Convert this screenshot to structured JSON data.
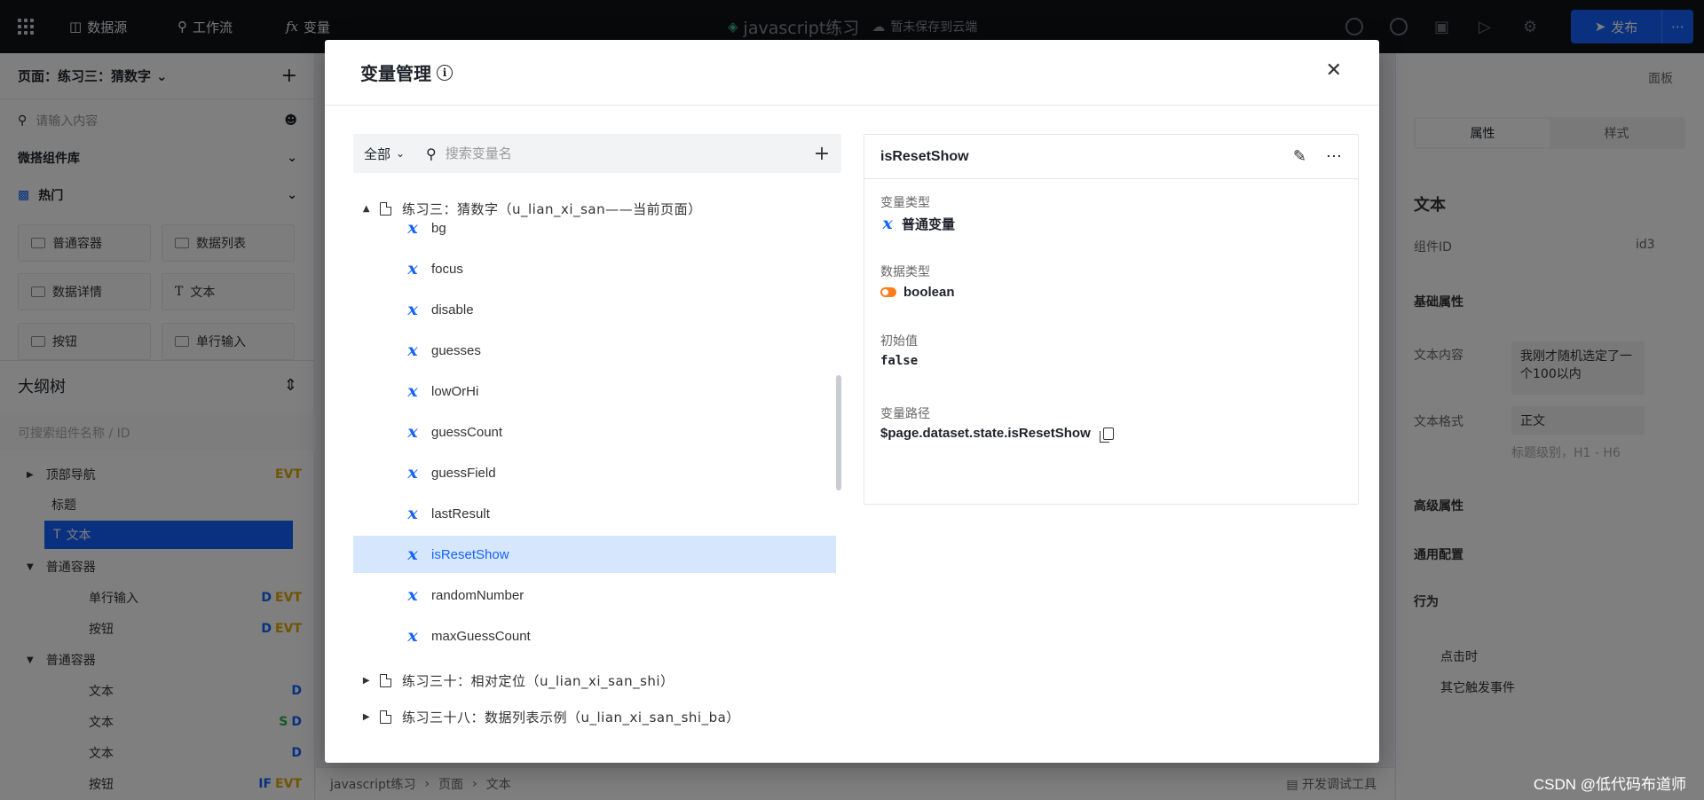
{
  "topbar": {
    "datasource": "数据源",
    "workflow": "工作流",
    "variable": "变量",
    "app_title": "javascript练习",
    "save_status": "暂未保存到云端",
    "publish": "发布"
  },
  "left": {
    "page_label": "页面：练习三：猜数字",
    "search_placeholder": "请输入内容",
    "lib_title": "微搭组件库",
    "hot_title": "热门",
    "cards": [
      "普通容器",
      "数据列表",
      "数据详情",
      "文本",
      "按钮",
      "单行输入"
    ],
    "outline_title": "大纲树",
    "outline_search_placeholder": "可搜索组件名称 / ID",
    "tree": [
      {
        "label": "顶部导航",
        "badges": "EVT"
      },
      {
        "label": "标题",
        "badges": ""
      },
      {
        "label": "文本",
        "badges": ""
      },
      {
        "label": "普通容器",
        "badges": ""
      },
      {
        "label": "单行输入",
        "badges_d": "D",
        "badges_e": "EVT"
      },
      {
        "label": "按钮",
        "badges_d": "D",
        "badges_e": "EVT"
      },
      {
        "label": "普通容器",
        "badges": ""
      },
      {
        "label": "文本",
        "badges_d": "D"
      },
      {
        "label": "文本",
        "badges_s": "S",
        "badges_d": "D"
      },
      {
        "label": "文本",
        "badges_d": "D"
      },
      {
        "label": "按钮",
        "badges_if": "IF",
        "badges_e": "EVT"
      }
    ]
  },
  "right": {
    "panel_label": "面板",
    "tab_props": "属性",
    "tab_style": "样式",
    "section_title": "文本",
    "component_id_label": "组件ID",
    "component_id_value": "id3",
    "basic_props": "基础属性",
    "text_content_label": "文本内容",
    "text_content_value": "我刚才随机选定了一个100以内",
    "text_format_label": "文本格式",
    "text_format_value": "正文",
    "text_format_hint": "标题级别，H1 - H6",
    "advanced": "高级属性",
    "general": "通用配置",
    "behavior": "行为",
    "on_click": "点击时",
    "other_events": "其它触发事件"
  },
  "bottombar": {
    "crumbs": [
      "javascript练习",
      "页面",
      "文本"
    ],
    "devtools": "开发调试工具"
  },
  "modal": {
    "title": "变量管理",
    "filter_label": "全部",
    "search_placeholder": "搜索变量名",
    "groups": [
      "练习三：猜数字（u_lian_xi_san——当前页面）",
      "练习三十：相对定位（u_lian_xi_san_shi）",
      "练习三十八：数据列表示例（u_lian_xi_san_shi_ba）"
    ],
    "variables": [
      "bg",
      "focus",
      "disable",
      "guesses",
      "lowOrHi",
      "guessCount",
      "guessField",
      "lastResult",
      "isResetShow",
      "randomNumber",
      "maxGuessCount"
    ],
    "selected": "isResetShow",
    "detail": {
      "name": "isResetShow",
      "var_type_label": "变量类型",
      "var_type_value": "普通变量",
      "data_type_label": "数据类型",
      "data_type_value": "boolean",
      "init_label": "初始值",
      "init_value": "false",
      "path_label": "变量路径",
      "path_value": "$page.dataset.state.isResetShow"
    }
  },
  "watermark": "CSDN @低代码布道师",
  "colors": {
    "accent": "#1463ff",
    "selected_bg": "#d6e6fd",
    "boolean_toggle": "#ff7d1a"
  }
}
